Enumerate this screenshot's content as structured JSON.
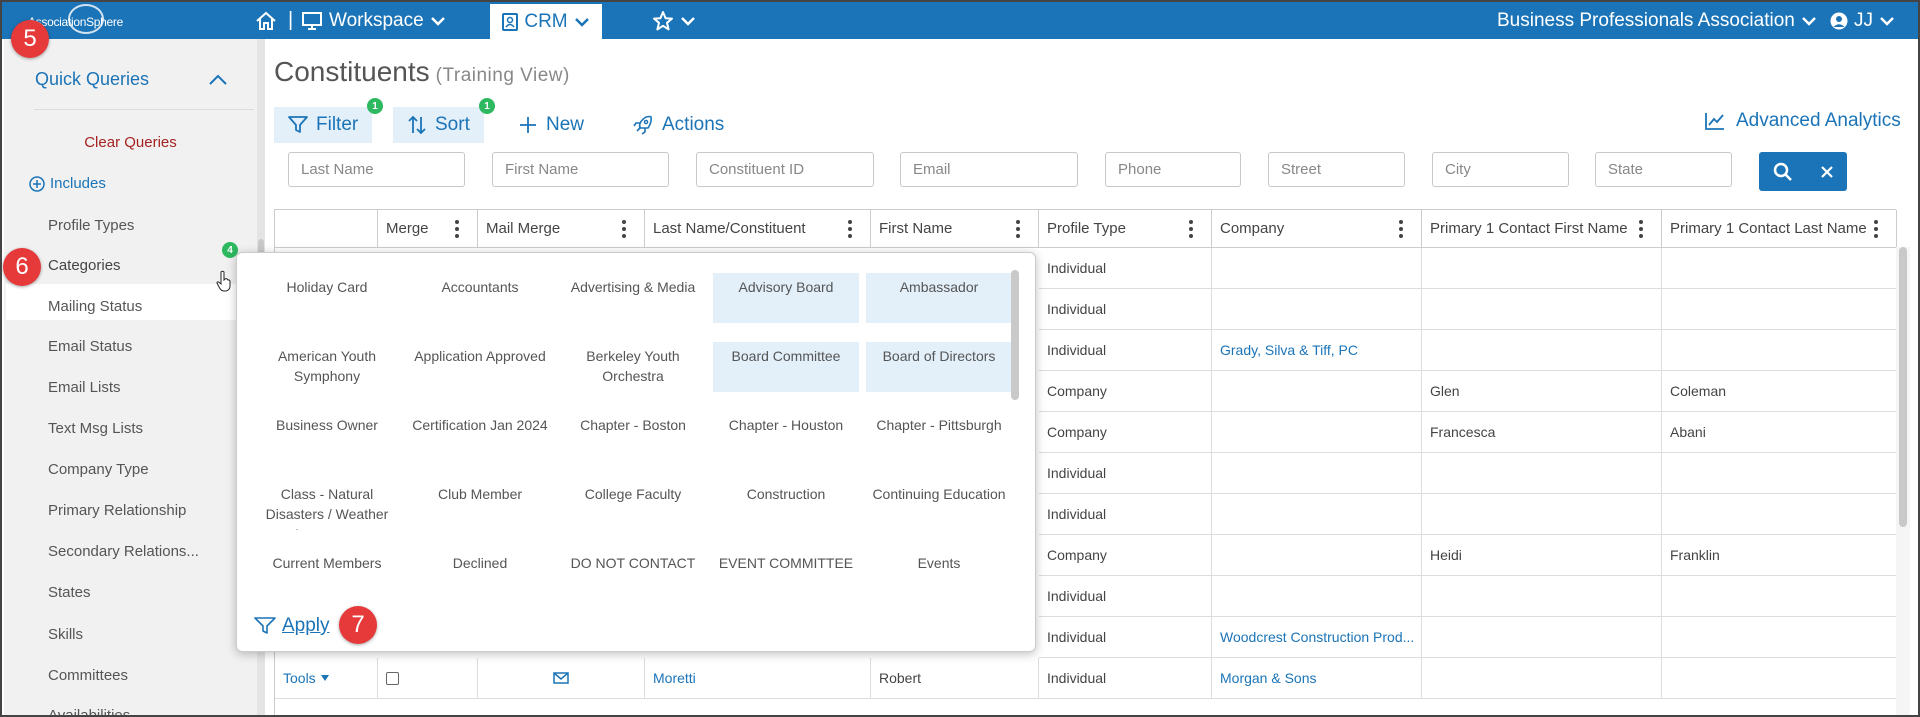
{
  "topbar": {
    "logo_text": "AssociationSphere",
    "workspace_label": "Workspace",
    "crm_label": "CRM",
    "org_name": "Business Professionals Association",
    "user_initials": "JJ",
    "icons": [
      "home-icon",
      "monitor-icon",
      "chevron-down-icon",
      "star-icon",
      "user-circle-icon"
    ]
  },
  "sidebar": {
    "section_title": "Quick Queries",
    "clear_label": "Clear Queries",
    "includes_label": "Includes",
    "items": [
      {
        "label": "Profile Types"
      },
      {
        "label": "Categories",
        "badge": "4"
      },
      {
        "label": "Mailing Status"
      },
      {
        "label": "Email Status"
      },
      {
        "label": "Email Lists"
      },
      {
        "label": "Text Msg Lists"
      },
      {
        "label": "Company Type"
      },
      {
        "label": "Primary Relationship"
      },
      {
        "label": "Secondary Relations..."
      },
      {
        "label": "States"
      },
      {
        "label": "Skills"
      },
      {
        "label": "Committees"
      },
      {
        "label": "Availabilities"
      }
    ]
  },
  "steps": [
    "5",
    "6",
    "7"
  ],
  "page": {
    "title": "Constituents",
    "subtitle": "(Training View)"
  },
  "toolbar": {
    "filter_label": "Filter",
    "filter_badge": "1",
    "sort_label": "Sort",
    "sort_badge": "1",
    "new_label": "New",
    "actions_label": "Actions",
    "analytics_label": "Advanced Analytics"
  },
  "search": {
    "last_name": "Last Name",
    "first_name": "First Name",
    "constituent_id": "Constituent ID",
    "email": "Email",
    "phone": "Phone",
    "street": "Street",
    "city": "City",
    "state": "State"
  },
  "grid": {
    "columns": [
      "",
      "Merge",
      "Mail Merge",
      "Last Name/Constituent",
      "First Name",
      "Profile Type",
      "Company",
      "Primary 1 Contact First Name",
      "Primary 1 Contact Last Name"
    ],
    "rows": [
      {
        "profile": "Individual",
        "company": "",
        "p1_first": "",
        "p1_last": ""
      },
      {
        "profile": "Individual",
        "company": "",
        "p1_first": "",
        "p1_last": ""
      },
      {
        "profile": "Individual",
        "company": "Grady, Silva & Tiff, PC",
        "p1_first": "",
        "p1_last": ""
      },
      {
        "profile": "Company",
        "company": "",
        "p1_first": "Glen",
        "p1_last": "Coleman"
      },
      {
        "profile": "Company",
        "company": "",
        "p1_first": "Francesca",
        "p1_last": "Abani"
      },
      {
        "profile": "Individual",
        "company": "",
        "p1_first": "",
        "p1_last": ""
      },
      {
        "profile": "Individual",
        "company": "",
        "p1_first": "",
        "p1_last": ""
      },
      {
        "profile": "Company",
        "company": "",
        "p1_first": "Heidi",
        "p1_last": "Franklin"
      },
      {
        "profile": "Individual",
        "company": "",
        "p1_first": "",
        "p1_last": ""
      },
      {
        "profile": "Individual",
        "company": "Woodcrest Construction Prod...",
        "p1_first": "",
        "p1_last": ""
      },
      {
        "tools": "Tools",
        "last_name": "Moretti",
        "first_name": "Robert",
        "profile": "Individual",
        "company": "Morgan & Sons",
        "p1_first": "",
        "p1_last": ""
      }
    ]
  },
  "categories_popup": {
    "items": [
      {
        "label": "Holiday Card",
        "selected": false
      },
      {
        "label": "Accountants",
        "selected": false
      },
      {
        "label": "Advertising & Media",
        "selected": false
      },
      {
        "label": "Advisory Board",
        "selected": true
      },
      {
        "label": "Ambassador",
        "selected": true
      },
      {
        "label": "American Youth Symphony",
        "selected": false
      },
      {
        "label": "Application Approved",
        "selected": false
      },
      {
        "label": "Berkeley Youth Orchestra",
        "selected": false
      },
      {
        "label": "Board Committee",
        "selected": true
      },
      {
        "label": "Board of Directors",
        "selected": true
      },
      {
        "label": "Business Owner",
        "selected": false
      },
      {
        "label": "Certification Jan 2024",
        "selected": false
      },
      {
        "label": "Chapter - Boston",
        "selected": false
      },
      {
        "label": "Chapter - Houston",
        "selected": false
      },
      {
        "label": "Chapter - Pittsburgh",
        "selected": false
      },
      {
        "label": "Class - Natural Disasters / Weather Awareness",
        "selected": false
      },
      {
        "label": "Club Member",
        "selected": false
      },
      {
        "label": "College Faculty",
        "selected": false
      },
      {
        "label": "Construction",
        "selected": false
      },
      {
        "label": "Continuing Education",
        "selected": false
      },
      {
        "label": "Current Members",
        "selected": false
      },
      {
        "label": "Declined",
        "selected": false
      },
      {
        "label": "DO NOT CONTACT",
        "selected": false
      },
      {
        "label": "EVENT COMMITTEE",
        "selected": false
      },
      {
        "label": "Events",
        "selected": false
      }
    ],
    "apply_label": "Apply"
  },
  "colors": {
    "brand_blue": "#1b74b7",
    "selected_bg": "#e3eff9",
    "badge_green": "#2eb860",
    "step_red": "#e5393a",
    "clear_red": "#a52222"
  }
}
